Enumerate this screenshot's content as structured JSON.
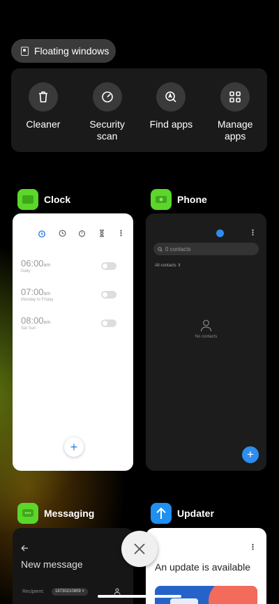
{
  "floating_windows": {
    "label": "Floating windows"
  },
  "quick_actions": [
    {
      "label": "Cleaner",
      "icon": "trash-icon"
    },
    {
      "label": "Security\nscan",
      "icon": "shield-scan-icon"
    },
    {
      "label": "Find apps",
      "icon": "find-apps-icon"
    },
    {
      "label": "Manage\napps",
      "icon": "grid-icon"
    }
  ],
  "apps": {
    "clock": {
      "name": "Clock",
      "alarms": [
        {
          "time": "06:00",
          "ampm": "am",
          "sub": "Daily"
        },
        {
          "time": "07:00",
          "ampm": "am",
          "sub": "Monday to Friday"
        },
        {
          "time": "08:00",
          "ampm": "am",
          "sub": "Sat Sun"
        }
      ]
    },
    "phone": {
      "name": "Phone",
      "search_placeholder": "0 contacts",
      "filter": "All contacts",
      "empty": "No contacts"
    },
    "messaging": {
      "name": "Messaging",
      "title": "New message",
      "recipient_label": "Recipient:",
      "recipient": "18730210809"
    },
    "updater": {
      "name": "Updater",
      "message": "An update is available"
    }
  },
  "colors": {
    "accent_blue": "#2d7fe6",
    "clock_icon_bg": "#5bd62a",
    "updater_icon_bg": "#1f8ff0"
  }
}
